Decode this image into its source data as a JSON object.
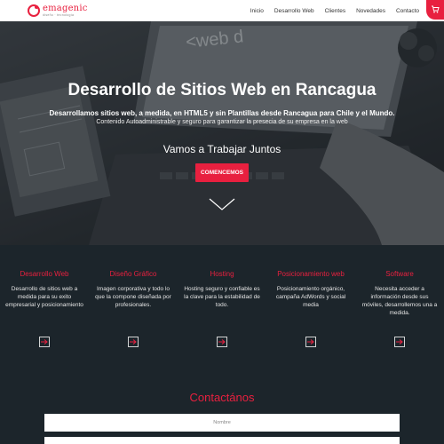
{
  "brand": {
    "name": "emagenic",
    "tagline": "diseño · tecnología",
    "accent": "#e8203f",
    "dark_bg": "#1c252b"
  },
  "nav": {
    "items": [
      "Inicio",
      "Desarrollo Web",
      "Clientes",
      "Novedades",
      "Contacto"
    ],
    "cart_icon": "cart-icon"
  },
  "hero": {
    "title": "Desarrollo de Sitios Web en Rancagua",
    "subtitle_bold": "Desarrollamos sitios web, a medida, en HTML5 y sin Plantillas desde Rancagua para Chile y el Mundo.",
    "subtitle": "Contenido Autoadministrable y seguro para garantizar la presecia de su empresa en la web",
    "cta_text": "Vamos a Trabajar Juntos",
    "button": "COMENCEMOS",
    "scroll_icon": "chevron-down-icon"
  },
  "services": [
    {
      "title": "Desarrollo Web",
      "desc": "Desarrollo de sitios web a medida para su exito empresarial y posicionamiento"
    },
    {
      "title": "Diseño Gráfico",
      "desc": "Imagen corporativa y todo lo que la compone diseñada por profesionales."
    },
    {
      "title": "Hosting",
      "desc": "Hosting seguro y confiable es la clave para la estabilidad de todo."
    },
    {
      "title": "Posicionamiento web",
      "desc": "Posicionamiento orgánico, campaña AdWords y social media"
    },
    {
      "title": "Software",
      "desc": "Necesita acceder a información desde sus móviles, desarrollemos una a medida."
    }
  ],
  "service_link_icon": "arrow-right-icon",
  "contact": {
    "title": "Contactános",
    "name_placeholder": "Nombre"
  }
}
